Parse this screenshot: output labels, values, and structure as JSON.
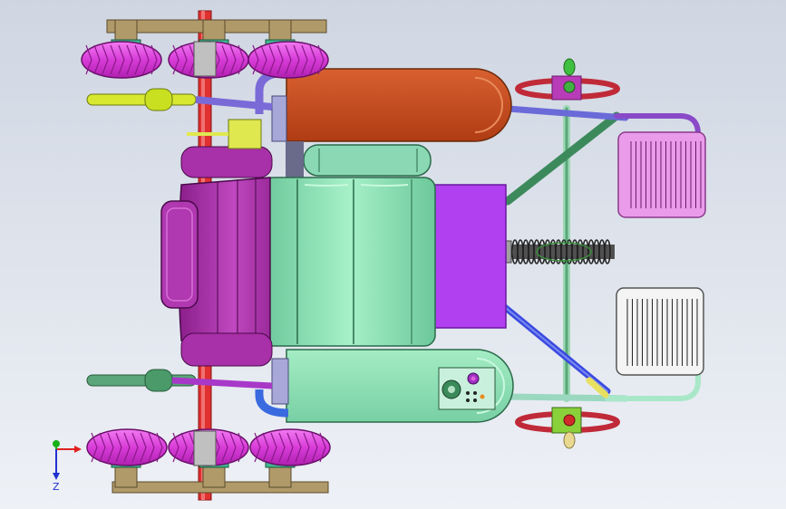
{
  "viewport": {
    "background_top": "#cfd6e2",
    "background_bottom": "#eef1f6"
  },
  "triad": {
    "x_axis_color": "#e02020",
    "y_axis_color": "#18b018",
    "z_axis_color": "#2030d0",
    "z_label": "Z"
  },
  "colors": {
    "tire": "#e04ce0",
    "hub_bronze": "#b09a6a",
    "hub_teal": "#40b890",
    "axle_red": "#e03030",
    "fuel_tank": "#c44a1c",
    "battery_box": "#8fe0b4",
    "seat": "#a830a8",
    "bench": "#8ae0b0",
    "purple_panel": "#b040f0",
    "frame_green": "#3c8a5c",
    "pedal": "#ea9cea",
    "pedal_white": "#f4f4f4",
    "steering": "#c02a38",
    "motor_box": "#8cc0e0",
    "spring": "#303030",
    "handle_yellow": "#d8e830",
    "pipe_blue": "#3a6ae0"
  }
}
